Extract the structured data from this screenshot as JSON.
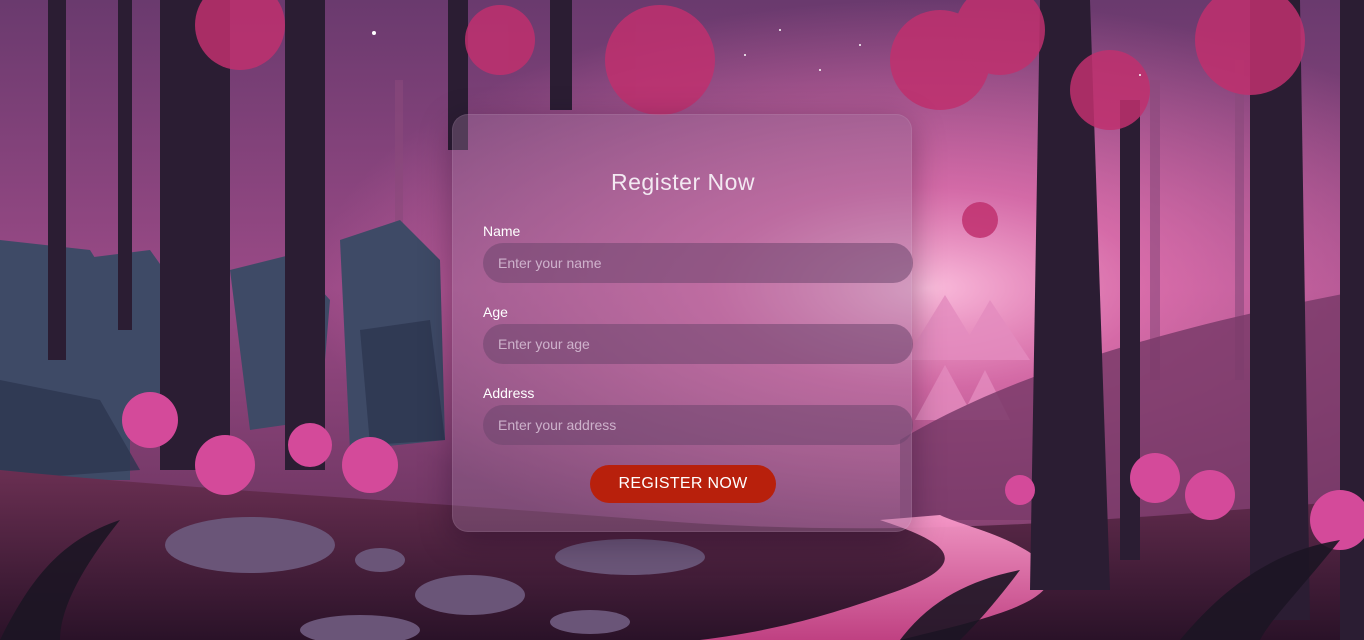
{
  "form": {
    "title": "Register Now",
    "fields": [
      {
        "label": "Name",
        "placeholder": "Enter your name",
        "value": ""
      },
      {
        "label": "Age",
        "placeholder": "Enter your age",
        "value": ""
      },
      {
        "label": "Address",
        "placeholder": "Enter your address",
        "value": ""
      }
    ],
    "submit_label": "REGISTER NOW"
  },
  "colors": {
    "accent": "#b8200c",
    "sky": "#a0508a",
    "glow": "#f27ab8"
  }
}
